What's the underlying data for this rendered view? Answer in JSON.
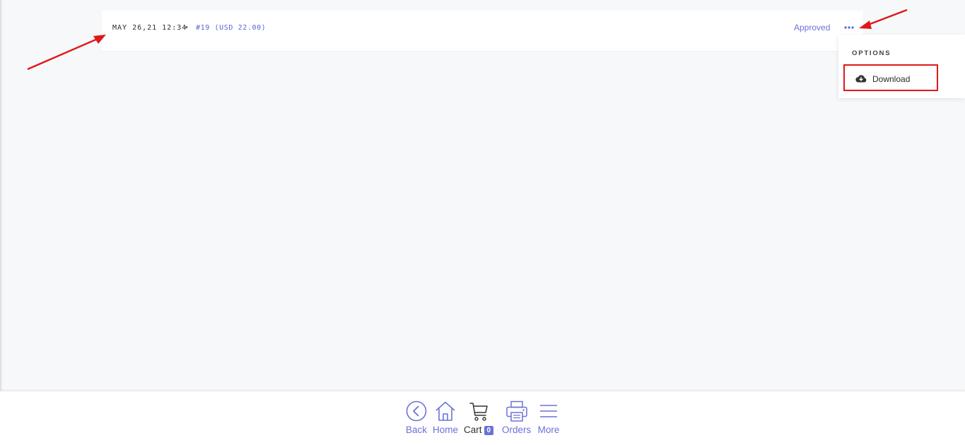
{
  "order": {
    "date": "MAY 26,21 12:34",
    "separator": "•",
    "reference": "#19 (USD 22.00)",
    "status": "Approved",
    "options_icon": "ellipsis-icon"
  },
  "options_menu": {
    "heading": "OPTIONS",
    "items": [
      {
        "label": "Download",
        "icon": "cloud-download-icon"
      }
    ]
  },
  "bottom_nav": {
    "items": [
      {
        "label": "Back",
        "icon": "back-circle-icon"
      },
      {
        "label": "Home",
        "icon": "home-icon"
      },
      {
        "label": "Cart",
        "icon": "cart-icon",
        "badge": "0"
      },
      {
        "label": "Orders",
        "icon": "printer-icon"
      },
      {
        "label": "More",
        "icon": "menu-lines-icon"
      }
    ]
  },
  "colors": {
    "accent": "#6a72d8",
    "annotation": "#e01818",
    "background": "#f7f8fa"
  }
}
